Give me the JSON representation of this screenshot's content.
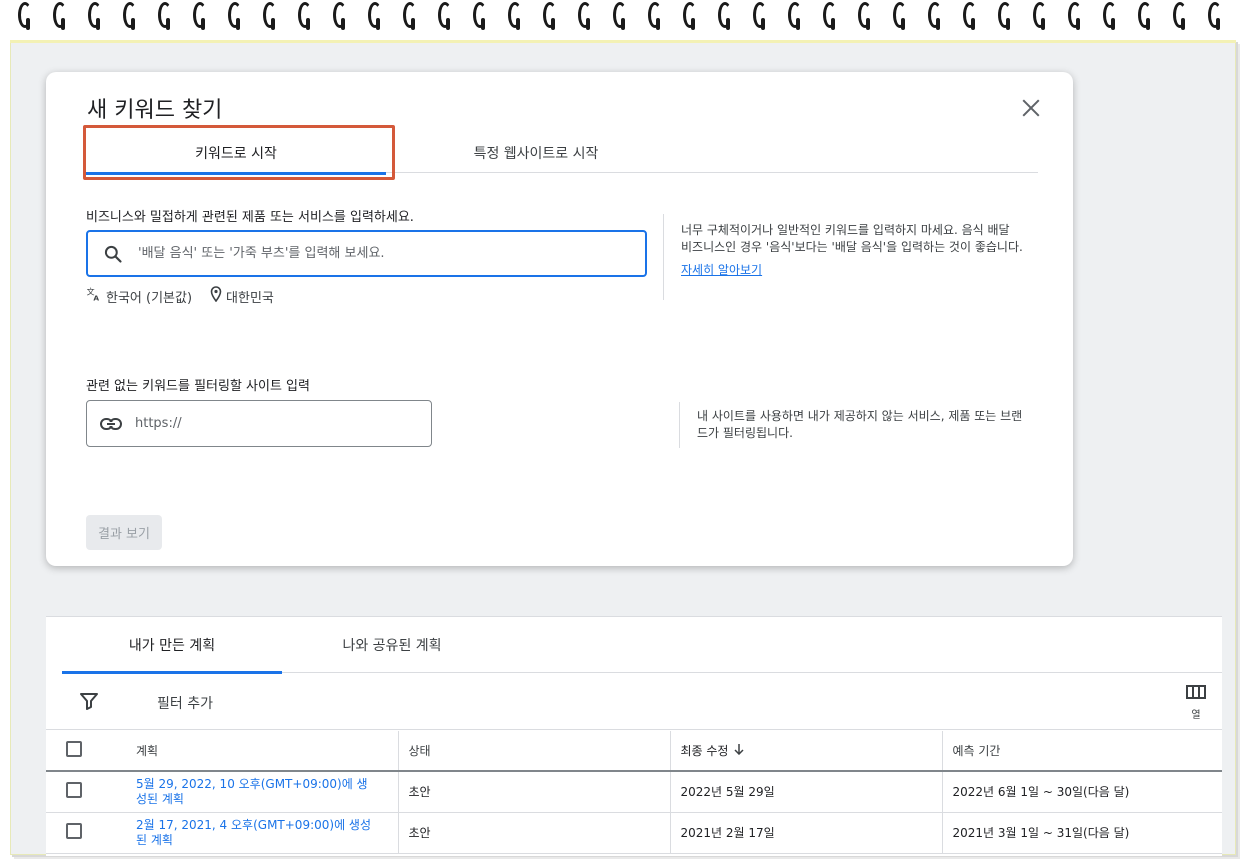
{
  "dialog": {
    "title": "새 키워드 찾기",
    "tabs": [
      {
        "label": "키워드로 시작",
        "active": true
      },
      {
        "label": "특정 웹사이트로 시작",
        "active": false
      }
    ],
    "keyword_section": {
      "label": "비즈니스와 밀접하게 관련된 제품 또는 서비스를 입력하세요.",
      "placeholder": "'배달 음식' 또는 '가죽 부츠'를 입력해 보세요.",
      "language": "한국어 (기본값)",
      "location": "대한민국",
      "note": "너무 구체적이거나 일반적인 키워드를 입력하지 마세요. 음식 배달 비즈니스인 경우 '음식'보다는 '배달 음식'을 입력하는 것이 좋습니다.",
      "learn_more": "자세히 알아보기"
    },
    "site_section": {
      "label": "관련 없는 키워드를 필터링할 사이트 입력",
      "placeholder": "https://",
      "note": "내 사이트를 사용하면 내가 제공하지 않는 서비스, 제품 또는 브랜드가 필터링됩니다."
    },
    "result_button": "결과 보기",
    "accent_color": "#1a73e8",
    "highlight_color": "#d4593a"
  },
  "plans": {
    "tabs": [
      {
        "label": "내가 만든 계획",
        "active": true
      },
      {
        "label": "나와 공유된 계획",
        "active": false
      }
    ],
    "filter_label": "필터 추가",
    "columns_label": "열",
    "headers": {
      "plan": "계획",
      "status": "상태",
      "last_modified": "최종 수정",
      "forecast": "예측 기간"
    },
    "rows": [
      {
        "plan": "5월 29, 2022, 10 오후(GMT+09:00)에 생성된 계획",
        "status": "초안",
        "last_modified": "2022년 5월 29일",
        "forecast": "2022년 6월 1일 ~ 30일(다음 달)"
      },
      {
        "plan": "2월 17, 2021, 4 오후(GMT+09:00)에 생성된 계획",
        "status": "초안",
        "last_modified": "2021년 2월 17일",
        "forecast": "2021년 3월 1일 ~ 31일(다음 달)"
      }
    ]
  }
}
